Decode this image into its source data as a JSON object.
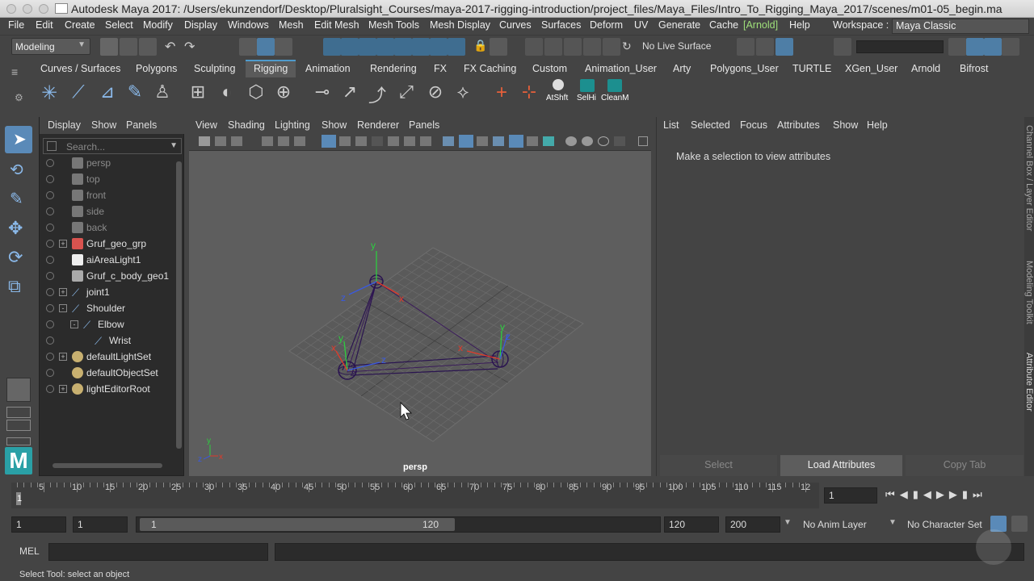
{
  "window": {
    "title": "Autodesk Maya 2017: /Users/ekunzendorf/Desktop/Pluralsight_Courses/maya-2017-rigging-introduction/project_files/Maya_Files/Intro_To_Rigging_Maya_2017/scenes/m01-05_begin.ma"
  },
  "menubar": {
    "items": [
      "File",
      "Edit",
      "Create",
      "Select",
      "Modify",
      "Display",
      "Windows",
      "Mesh",
      "Edit Mesh",
      "Mesh Tools",
      "Mesh Display",
      "Curves",
      "Surfaces",
      "Deform",
      "UV",
      "Generate",
      "Cache",
      "[Arnold]",
      "Help"
    ],
    "workspace_label": "Workspace :",
    "workspace_value": "Maya Classic"
  },
  "status": {
    "menuset": "Modeling",
    "live_surface": "No Live Surface"
  },
  "shelf": {
    "tabs": [
      "Curves / Surfaces",
      "Polygons",
      "Sculpting",
      "Rigging",
      "Animation",
      "Rendering",
      "FX",
      "FX Caching",
      "Custom",
      "Animation_User",
      "Arty",
      "Polygons_User",
      "TURTLE",
      "XGen_User",
      "Arnold",
      "Bifrost"
    ],
    "active_tab": "Rigging",
    "custom_buttons": [
      "AtShft",
      "SelHi",
      "CleanM"
    ]
  },
  "outliner": {
    "menu": [
      "Display",
      "Show",
      "Panels"
    ],
    "search_placeholder": "Search...",
    "items": [
      {
        "label": "persp",
        "icon": "camera-icon",
        "dim": true,
        "indent": 0,
        "expand": ""
      },
      {
        "label": "top",
        "icon": "camera-icon",
        "dim": true,
        "indent": 0,
        "expand": ""
      },
      {
        "label": "front",
        "icon": "camera-icon",
        "dim": true,
        "indent": 0,
        "expand": ""
      },
      {
        "label": "side",
        "icon": "camera-icon",
        "dim": true,
        "indent": 0,
        "expand": ""
      },
      {
        "label": "back",
        "icon": "camera-icon",
        "dim": true,
        "indent": 0,
        "expand": ""
      },
      {
        "label": "Gruf_geo_grp",
        "icon": "group-icon",
        "dim": false,
        "indent": 0,
        "expand": "+"
      },
      {
        "label": "aiAreaLight1",
        "icon": "light-icon",
        "dim": false,
        "indent": 0,
        "expand": ""
      },
      {
        "label": "Gruf_c_body_geo1",
        "icon": "mesh-icon",
        "dim": false,
        "indent": 0,
        "expand": ""
      },
      {
        "label": "joint1",
        "icon": "joint-icon",
        "dim": false,
        "indent": 0,
        "expand": "+"
      },
      {
        "label": "Shoulder",
        "icon": "joint-icon",
        "dim": false,
        "indent": 0,
        "expand": "-"
      },
      {
        "label": "Elbow",
        "icon": "joint-icon",
        "dim": false,
        "indent": 1,
        "expand": "-"
      },
      {
        "label": "Wrist",
        "icon": "joint-icon",
        "dim": false,
        "indent": 2,
        "expand": ""
      },
      {
        "label": "defaultLightSet",
        "icon": "set-icon",
        "dim": false,
        "indent": 0,
        "expand": "+"
      },
      {
        "label": "defaultObjectSet",
        "icon": "set-icon",
        "dim": false,
        "indent": 0,
        "expand": ""
      },
      {
        "label": "lightEditorRoot",
        "icon": "set-icon",
        "dim": false,
        "indent": 0,
        "expand": "+"
      }
    ]
  },
  "viewport": {
    "menu": [
      "View",
      "Shading",
      "Lighting",
      "Show",
      "Renderer",
      "Panels"
    ],
    "camera_label": "persp",
    "axis_labels": {
      "x": "x",
      "y": "y",
      "z": "z"
    }
  },
  "attribute_editor": {
    "menu": [
      "List",
      "Selected",
      "Focus",
      "Attributes",
      "Show",
      "Help"
    ],
    "message": "Make a selection to view attributes",
    "buttons": [
      "Select",
      "Load Attributes",
      "Copy Tab"
    ],
    "side_tabs": [
      "Channel Box / Layer Editor",
      "Modeling Toolkit",
      "Attribute Editor"
    ]
  },
  "timeline": {
    "ticks": [
      "5",
      "10",
      "15",
      "20",
      "25",
      "30",
      "35",
      "40",
      "45",
      "50",
      "55",
      "60",
      "65",
      "70",
      "75",
      "80",
      "85",
      "90",
      "95",
      "100",
      "105",
      "110",
      "115",
      "12"
    ],
    "current_marker": "1",
    "current_frame": "1"
  },
  "range": {
    "start": "1",
    "anim_start": "1",
    "slider_start": "1",
    "slider_end": "120",
    "anim_end": "120",
    "end": "200",
    "anim_layer": "No Anim Layer",
    "character_set": "No Character Set"
  },
  "command": {
    "lang": "MEL"
  },
  "helpline": {
    "text": "Select Tool: select an object"
  }
}
